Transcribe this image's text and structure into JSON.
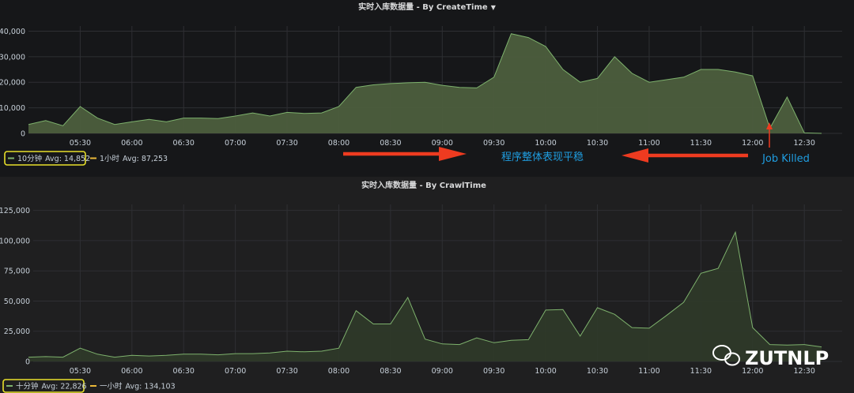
{
  "chart_data": [
    {
      "type": "area",
      "title": "实时入库数据量 - By CreateTime",
      "x": [
        "05:00",
        "05:10",
        "05:20",
        "05:30",
        "05:40",
        "05:50",
        "06:00",
        "06:10",
        "06:20",
        "06:30",
        "06:40",
        "06:50",
        "07:00",
        "07:10",
        "07:20",
        "07:30",
        "07:40",
        "07:50",
        "08:00",
        "08:10",
        "08:20",
        "08:30",
        "08:40",
        "08:50",
        "09:00",
        "09:10",
        "09:20",
        "09:30",
        "09:40",
        "09:50",
        "10:00",
        "10:10",
        "10:20",
        "10:30",
        "10:40",
        "10:50",
        "11:00",
        "11:10",
        "11:20",
        "11:30",
        "11:40",
        "11:50",
        "12:00",
        "12:10",
        "12:20",
        "12:30",
        "12:40"
      ],
      "xticks": [
        "05:30",
        "06:00",
        "06:30",
        "07:00",
        "07:30",
        "08:00",
        "08:30",
        "09:00",
        "09:30",
        "10:00",
        "10:30",
        "11:00",
        "11:30",
        "12:00",
        "12:30"
      ],
      "yticks": [
        "0",
        "10,000",
        "20,000",
        "30,000",
        "40,000"
      ],
      "ylim": [
        0,
        42000
      ],
      "series": [
        {
          "name": "10分钟",
          "avg": "Avg: 14,852",
          "color": "#7eb26d",
          "values": [
            3500,
            5000,
            3000,
            10500,
            6000,
            3500,
            4500,
            5500,
            4500,
            6000,
            6000,
            5800,
            6800,
            8000,
            6800,
            8200,
            7800,
            8000,
            10500,
            18000,
            19000,
            19500,
            19800,
            20000,
            18800,
            18000,
            17800,
            22000,
            39000,
            37500,
            34000,
            25000,
            20000,
            21500,
            30000,
            23500,
            20000,
            21000,
            22000,
            25000,
            25000,
            24000,
            22500,
            2000,
            14200,
            200,
            0
          ]
        },
        {
          "name": "1小时",
          "avg": "Avg: 87,253",
          "color": "#eab839",
          "values": []
        }
      ],
      "annotations": [
        {
          "text": "程序整体表现平稳"
        },
        {
          "text": "Job Killed"
        }
      ],
      "grid": true
    },
    {
      "type": "area",
      "title": "实时入库数据量 - By CrawlTime",
      "x": [
        "05:00",
        "05:10",
        "05:20",
        "05:30",
        "05:40",
        "05:50",
        "06:00",
        "06:10",
        "06:20",
        "06:30",
        "06:40",
        "06:50",
        "07:00",
        "07:10",
        "07:20",
        "07:30",
        "07:40",
        "07:50",
        "08:00",
        "08:10",
        "08:20",
        "08:30",
        "08:40",
        "08:50",
        "09:00",
        "09:10",
        "09:20",
        "09:30",
        "09:40",
        "09:50",
        "10:00",
        "10:10",
        "10:20",
        "10:30",
        "10:40",
        "10:50",
        "11:00",
        "11:10",
        "11:20",
        "11:30",
        "11:40",
        "11:50",
        "12:00",
        "12:10",
        "12:20",
        "12:30",
        "12:40"
      ],
      "xticks": [
        "05:30",
        "06:00",
        "06:30",
        "07:00",
        "07:30",
        "08:00",
        "08:30",
        "09:00",
        "09:30",
        "10:00",
        "10:30",
        "11:00",
        "11:30",
        "12:00",
        "12:30"
      ],
      "yticks": [
        "0",
        "25,000",
        "50,000",
        "75,000",
        "100,000",
        "125,000"
      ],
      "ylim": [
        0,
        130000
      ],
      "series": [
        {
          "name": "十分钟",
          "avg": "Avg: 22,826",
          "color": "#7eb26d",
          "values": [
            3500,
            4000,
            3500,
            11000,
            6000,
            3500,
            5000,
            4500,
            5000,
            6000,
            6000,
            5500,
            6500,
            6500,
            7000,
            8500,
            8000,
            8500,
            11000,
            42000,
            31000,
            31000,
            53000,
            18500,
            14500,
            14000,
            19500,
            15500,
            17500,
            18000,
            42500,
            43000,
            21000,
            44500,
            39000,
            28000,
            27500,
            38000,
            49000,
            73000,
            77000,
            107000,
            28000,
            14000,
            13500,
            14000,
            12000
          ]
        },
        {
          "name": "一小时",
          "avg": "Avg: 134,103",
          "color": "#eab839",
          "values": []
        }
      ],
      "grid": true
    }
  ],
  "watermark": {
    "text": "ZUTNLP"
  }
}
